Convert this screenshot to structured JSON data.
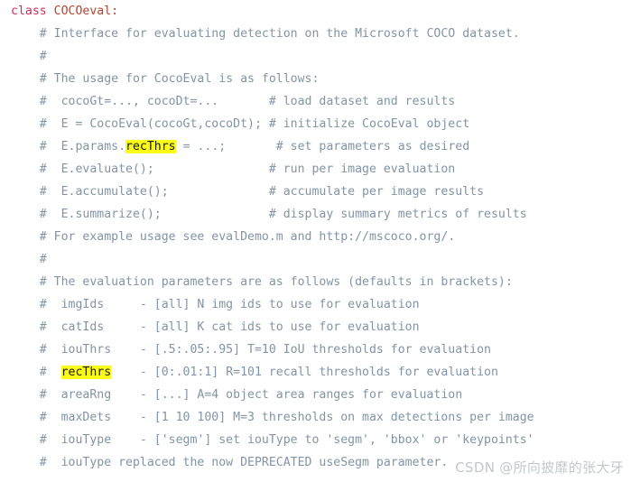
{
  "editor": {
    "background_color": "#ffffff",
    "comment_color": "#8294a5",
    "keyword_color": "#d42a5c",
    "classname_color": "#b5432f",
    "highlight_background": "#fbfb18",
    "highlight_text_color": "#1c1c1c",
    "font": "monospace",
    "line_count": 20
  },
  "watermark": {
    "text": "CSDN @所向披靡的张大牙",
    "color": "#c3c8cd"
  },
  "lines": [
    {
      "id": "line-1",
      "segments": [
        {
          "text": "class ",
          "type": "keyword"
        },
        {
          "text": "COCOeval:",
          "type": "classname"
        }
      ]
    },
    {
      "id": "line-2",
      "segments": [
        {
          "text": "    # Interface for evaluating detection on the Microsoft COCO dataset.",
          "type": "comment"
        }
      ]
    },
    {
      "id": "line-3",
      "segments": [
        {
          "text": "    #",
          "type": "comment"
        }
      ]
    },
    {
      "id": "line-4",
      "segments": [
        {
          "text": "    # The usage for CocoEval is as follows:",
          "type": "comment"
        }
      ]
    },
    {
      "id": "line-5",
      "segments": [
        {
          "text": "    #  cocoGt=..., cocoDt=...       # load dataset and results",
          "type": "comment"
        }
      ]
    },
    {
      "id": "line-6",
      "segments": [
        {
          "text": "    #  E = CocoEval(cocoGt,cocoDt); # initialize CocoEval object",
          "type": "comment"
        }
      ]
    },
    {
      "id": "line-7",
      "segments": [
        {
          "text": "    #  E.params.",
          "type": "comment"
        },
        {
          "text": "recThrs",
          "type": "highlight"
        },
        {
          "text": " = ...;       # set parameters as desired",
          "type": "comment"
        }
      ]
    },
    {
      "id": "line-8",
      "segments": [
        {
          "text": "    #  E.evaluate();                # run per image evaluation",
          "type": "comment"
        }
      ]
    },
    {
      "id": "line-9",
      "segments": [
        {
          "text": "    #  E.accumulate();              # accumulate per image results",
          "type": "comment"
        }
      ]
    },
    {
      "id": "line-10",
      "segments": [
        {
          "text": "    #  E.summarize();               # display summary metrics of results",
          "type": "comment"
        }
      ]
    },
    {
      "id": "line-11",
      "segments": [
        {
          "text": "    # For example usage see evalDemo.m and http://mscoco.org/.",
          "type": "comment"
        }
      ]
    },
    {
      "id": "line-12",
      "segments": [
        {
          "text": "    #",
          "type": "comment"
        }
      ]
    },
    {
      "id": "line-13",
      "segments": [
        {
          "text": "    # The evaluation parameters are as follows (defaults in brackets):",
          "type": "comment"
        }
      ]
    },
    {
      "id": "line-14",
      "segments": [
        {
          "text": "    #  imgIds     - [all] N img ids to use for evaluation",
          "type": "comment"
        }
      ]
    },
    {
      "id": "line-15",
      "segments": [
        {
          "text": "    #  catIds     - [all] K cat ids to use for evaluation",
          "type": "comment"
        }
      ]
    },
    {
      "id": "line-16",
      "segments": [
        {
          "text": "    #  iouThrs    - [.5:.05:.95] T=10 IoU thresholds for evaluation",
          "type": "comment"
        }
      ]
    },
    {
      "id": "line-17",
      "segments": [
        {
          "text": "    #  ",
          "type": "comment"
        },
        {
          "text": "recThrs",
          "type": "highlight"
        },
        {
          "text": "    - [0:.01:1] R=101 recall thresholds for evaluation",
          "type": "comment"
        }
      ]
    },
    {
      "id": "line-18",
      "segments": [
        {
          "text": "    #  areaRng    - [...] A=4 object area ranges for evaluation",
          "type": "comment"
        }
      ]
    },
    {
      "id": "line-19",
      "segments": [
        {
          "text": "    #  maxDets    - [1 10 100] M=3 thresholds on max detections per image",
          "type": "comment"
        }
      ]
    },
    {
      "id": "line-20",
      "segments": [
        {
          "text": "    #  iouType    - ['segm'] set iouType to 'segm', 'bbox' or 'keypoints'",
          "type": "comment"
        }
      ]
    },
    {
      "id": "line-21",
      "segments": [
        {
          "text": "    #  iouType replaced the now DEPRECATED useSegm parameter.",
          "type": "comment"
        }
      ]
    }
  ]
}
